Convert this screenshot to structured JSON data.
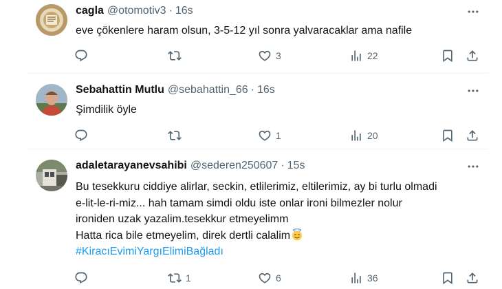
{
  "tweets": [
    {
      "display_name": "cagla",
      "handle": "@otomotiv3",
      "separator": "·",
      "time": "16s",
      "lines": [
        "eve çökenlere haram olsun, 3-5-12 yıl sonra yalvaracaklar ama nafile"
      ],
      "hashtag": "",
      "replies": "",
      "retweets": "",
      "likes": "3",
      "views": "22"
    },
    {
      "display_name": "Sebahattin Mutlu",
      "handle": "@sebahattin_66",
      "separator": "·",
      "time": "16s",
      "lines": [
        "Şimdilik öyle"
      ],
      "hashtag": "",
      "replies": "",
      "retweets": "",
      "likes": "1",
      "views": "20"
    },
    {
      "display_name": "adaletarayanevsahibi",
      "handle": "@sederen250607",
      "separator": "·",
      "time": "15s",
      "lines": [
        "Bu tesekkuru ciddiye alirlar, seckin,  etlilerimiz, eltilerimiz, ay bi turlu olmadi",
        "e-lit-le-ri-miz... hah tamam simdi oldu iste onlar  ironi bilmezler nolur",
        "ironiden uzak yazalim.tesekkur etmeyelimm",
        "Hatta rica bile etmeyelim, direk dertli calalim"
      ],
      "hashtag": "#KiracıEvimiYargıElimiBağladı",
      "replies": "",
      "retweets": "1",
      "likes": "6",
      "views": "36"
    }
  ],
  "colors": {
    "text": "#0f1419",
    "secondary": "#536471",
    "link": "#1d9bf0",
    "divider": "#eff3f4"
  },
  "icons": [
    "reply-icon",
    "retweet-icon",
    "like-icon",
    "views-icon",
    "bookmark-icon",
    "share-icon",
    "more-icon",
    "smiling-face-with-halo-emoji"
  ]
}
